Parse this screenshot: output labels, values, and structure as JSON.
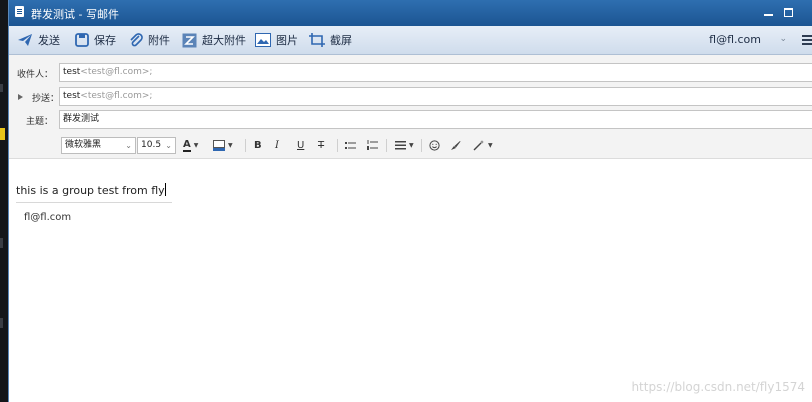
{
  "window": {
    "title": "群发测试 - 写邮件"
  },
  "toolbar": {
    "send": "发送",
    "save": "保存",
    "attach": "附件",
    "big_attach": "超大附件",
    "image": "图片",
    "screenshot": "截屏",
    "account": "fl@fl.com"
  },
  "fields": {
    "to_label": "收件人：",
    "to_name": "test",
    "to_addr": "<test@fl.com>;",
    "cc_label": "抄送：",
    "cc_name": "test",
    "cc_addr": "<test@fl.com>;",
    "subject_label": "主题：",
    "subject_value": "群发测试"
  },
  "format": {
    "font_family": "微软雅黑",
    "font_size": "10.5"
  },
  "body": {
    "text": "this is a group test from fly",
    "signature": "fl@fl.com"
  },
  "watermark": "https://blog.csdn.net/fly1574",
  "colors": {
    "titlebar": "#1c5592",
    "toolbar": "#dbe5f2"
  }
}
